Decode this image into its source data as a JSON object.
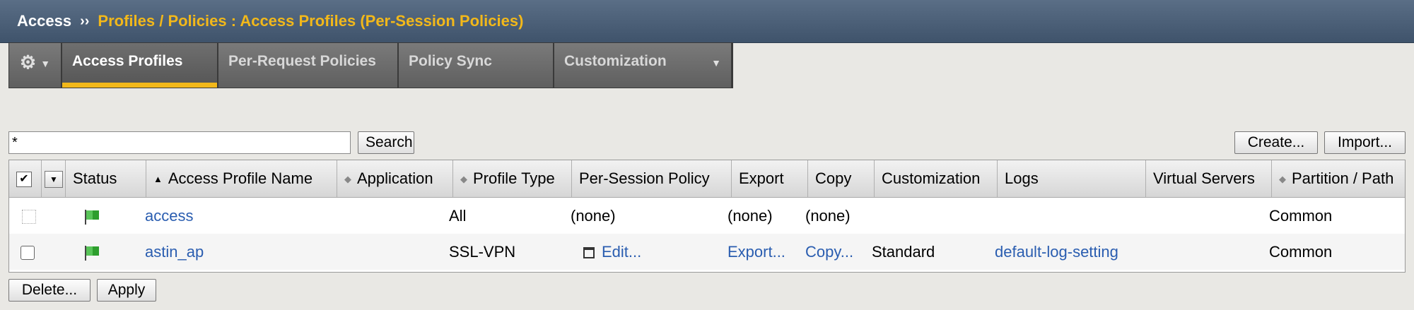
{
  "header": {
    "root": "Access",
    "separator": "››",
    "current": "Profiles / Policies : Access Profiles (Per-Session Policies)"
  },
  "tabs": [
    {
      "label": "Access Profiles",
      "active": true
    },
    {
      "label": "Per-Request Policies",
      "active": false
    },
    {
      "label": "Policy Sync",
      "active": false
    },
    {
      "label": "Customization",
      "active": false
    }
  ],
  "search": {
    "value": "*",
    "button": "Search"
  },
  "actions": {
    "create": "Create...",
    "import": "Import...",
    "delete": "Delete...",
    "apply": "Apply"
  },
  "table": {
    "columns": {
      "status": "Status",
      "name": "Access Profile Name",
      "application": "Application",
      "profile_type": "Profile Type",
      "per_session_policy": "Per-Session Policy",
      "export": "Export",
      "copy": "Copy",
      "customization": "Customization",
      "logs": "Logs",
      "virtual_servers": "Virtual Servers",
      "partition": "Partition / Path"
    },
    "rows": [
      {
        "name": "access",
        "application": "",
        "profile_type": "All",
        "per_session_policy": "(none)",
        "export": "(none)",
        "copy": "(none)",
        "customization": "",
        "logs": "",
        "virtual_servers": "",
        "partition": "Common"
      },
      {
        "name": "astin_ap",
        "application": "",
        "profile_type": "SSL-VPN",
        "per_session_policy": "Edit...",
        "export": "Export...",
        "copy": "Copy...",
        "customization": "Standard",
        "logs": "default-log-setting",
        "virtual_servers": "",
        "partition": "Common"
      }
    ]
  },
  "colors": {
    "accent": "#f2b81a",
    "link": "#2a5db0",
    "header_bg": "#4b5f77",
    "status_green": "#2e9e2e"
  },
  "icons": {
    "gear": "gear-icon",
    "status": "green-flag-icon",
    "edit": "edit-window-icon"
  }
}
